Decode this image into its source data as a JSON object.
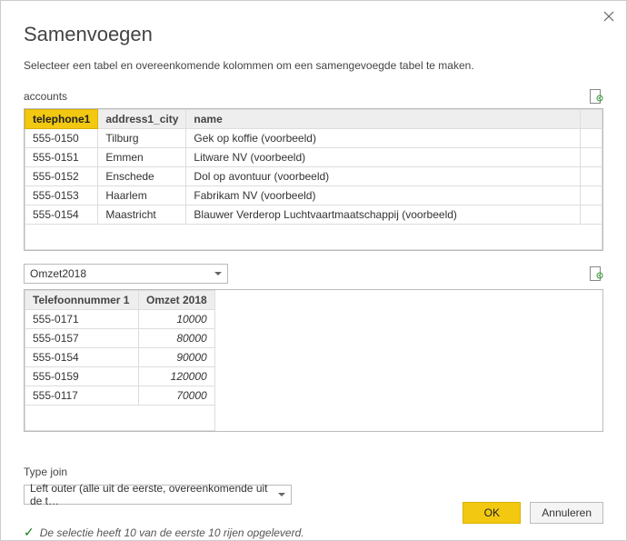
{
  "dialog": {
    "title": "Samenvoegen",
    "subtitle": "Selecteer een tabel en overeenkomende kolommen om een samengevoegde tabel te maken."
  },
  "table1": {
    "label": "accounts",
    "columns": [
      "telephone1",
      "address1_city",
      "name"
    ],
    "selected_column_index": 0,
    "rows": [
      {
        "telephone1": "555-0150",
        "address1_city": "Tilburg",
        "name": "Gek op koffie (voorbeeld)"
      },
      {
        "telephone1": "555-0151",
        "address1_city": "Emmen",
        "name": "Litware NV (voorbeeld)"
      },
      {
        "telephone1": "555-0152",
        "address1_city": "Enschede",
        "name": "Dol op avontuur (voorbeeld)"
      },
      {
        "telephone1": "555-0153",
        "address1_city": "Haarlem",
        "name": "Fabrikam NV (voorbeeld)"
      },
      {
        "telephone1": "555-0154",
        "address1_city": "Maastricht",
        "name": "Blauwer Verderop Luchtvaartmaatschappij (voorbeeld)"
      }
    ]
  },
  "table2_select": {
    "value": "Omzet2018"
  },
  "table2": {
    "columns": [
      "Telefoonnummer 1",
      "Omzet 2018"
    ],
    "rows": [
      {
        "tel": "555-0171",
        "omzet": "10000"
      },
      {
        "tel": "555-0157",
        "omzet": "80000"
      },
      {
        "tel": "555-0154",
        "omzet": "90000"
      },
      {
        "tel": "555-0159",
        "omzet": "120000"
      },
      {
        "tel": "555-0117",
        "omzet": "70000"
      }
    ]
  },
  "join": {
    "label": "Type join",
    "value": "Left outer (alle uit de eerste, overeenkomende uit de t…"
  },
  "status": {
    "message": "De selectie heeft 10 van de eerste 10 rijen opgeleverd."
  },
  "buttons": {
    "ok": "OK",
    "cancel": "Annuleren"
  }
}
